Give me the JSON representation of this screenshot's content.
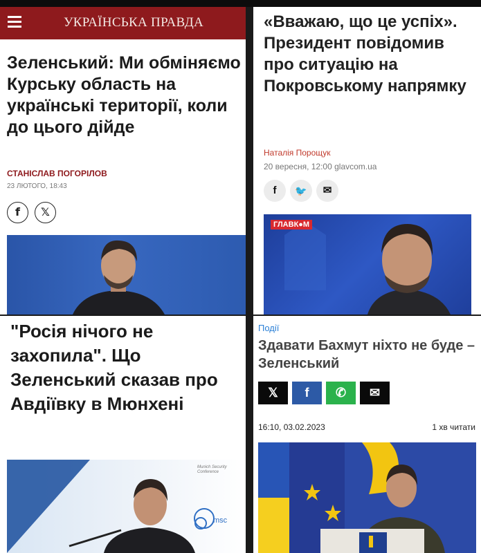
{
  "panel_up": {
    "site_name": "УКРАЇНСЬКА ПРАВДА",
    "headline": "Зеленський: Ми обміняємо Курську область на українські території, коли до цього дійде",
    "author": "СТАНІСЛАВ ПОГОРІЛОВ",
    "date": "23 ЛЮТОГО, 18:43",
    "share_icons": [
      "facebook-icon",
      "x-icon"
    ],
    "share": {
      "facebook": "f",
      "x": "𝕏"
    }
  },
  "panel_glavcom": {
    "headline": "«Вважаю, що це успіх». Президент повідомив про ситуацію на Покровському напрямку",
    "author": "Наталія Порощук",
    "date": "20 вересня, 12:00 glavcom.ua",
    "share_icons": [
      "facebook-icon",
      "twitter-icon",
      "email-icon"
    ],
    "share": {
      "facebook": "f",
      "twitter": "🐦",
      "email": "✉"
    },
    "photo_logo": "ГЛАВК●М",
    "colors": {
      "author": "#c0392b"
    }
  },
  "panel_munich": {
    "headline": "\"Росія нічого не захопила\". Що Зеленський сказав про Авдіївку в Мюнхені",
    "photo_sign": "Munich Security Conference",
    "photo_msc": "msc"
  },
  "panel_bakhmut": {
    "category": "Події",
    "headline": "Здавати Бахмут ніхто не буде – Зеленський",
    "share_icons": [
      "x-icon",
      "facebook-icon",
      "whatsapp-icon",
      "email-icon"
    ],
    "share": {
      "x": "𝕏",
      "facebook": "f",
      "whatsapp": "✆",
      "email": "✉"
    },
    "date": "16:10, 03.02.2023",
    "read_time": "1 хв читати",
    "colors": {
      "category": "#2a7fd6"
    }
  },
  "colors": {
    "up_brand": "#8e1a1d"
  }
}
